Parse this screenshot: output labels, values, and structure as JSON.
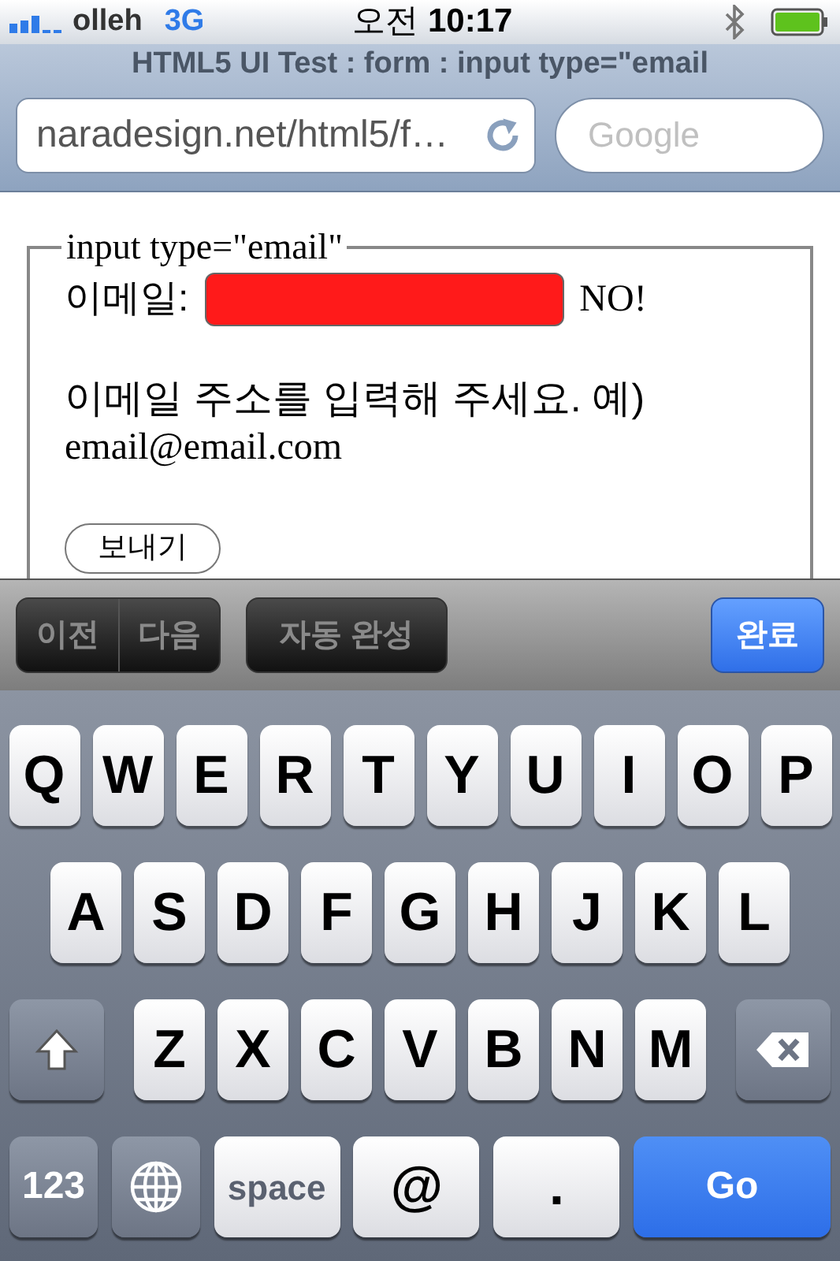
{
  "status_bar": {
    "carrier": "olleh",
    "network": "3G",
    "meridiem": "오전",
    "time": "10:17"
  },
  "browser": {
    "title": "HTML5 UI Test : form : input type=\"email",
    "address": "naradesign.net/html5/f…",
    "search_placeholder": "Google"
  },
  "form": {
    "legend": "input type=\"email\"",
    "field_label": "이메일:",
    "field_invalid": true,
    "field_message": "NO!",
    "hint": "이메일 주소를 입력해 주세요. 예)",
    "example": "email@email.com",
    "submit": "보내기"
  },
  "form_toolbar": {
    "nav": [
      {
        "label": "이전",
        "disabled": true
      },
      {
        "label": "다음",
        "disabled": true
      }
    ],
    "autofill": {
      "label": "자동 완성",
      "disabled": true
    },
    "done": "완료"
  },
  "keyboard": {
    "letter_rows": [
      [
        {
          "kind": "letter",
          "label": "Q"
        },
        {
          "kind": "letter",
          "label": "W"
        },
        {
          "kind": "letter",
          "label": "E"
        },
        {
          "kind": "letter",
          "label": "R"
        },
        {
          "kind": "letter",
          "label": "T"
        },
        {
          "kind": "letter",
          "label": "Y"
        },
        {
          "kind": "letter",
          "label": "U"
        },
        {
          "kind": "letter",
          "label": "I"
        },
        {
          "kind": "letter",
          "label": "O"
        },
        {
          "kind": "letter",
          "label": "P"
        }
      ],
      [
        {
          "kind": "letter",
          "label": "A"
        },
        {
          "kind": "letter",
          "label": "S"
        },
        {
          "kind": "letter",
          "label": "D"
        },
        {
          "kind": "letter",
          "label": "F"
        },
        {
          "kind": "letter",
          "label": "G"
        },
        {
          "kind": "letter",
          "label": "H"
        },
        {
          "kind": "letter",
          "label": "J"
        },
        {
          "kind": "letter",
          "label": "K"
        },
        {
          "kind": "letter",
          "label": "L"
        }
      ],
      [
        {
          "kind": "shift"
        },
        {
          "kind": "letter",
          "label": "Z"
        },
        {
          "kind": "letter",
          "label": "X"
        },
        {
          "kind": "letter",
          "label": "C"
        },
        {
          "kind": "letter",
          "label": "V"
        },
        {
          "kind": "letter",
          "label": "B"
        },
        {
          "kind": "letter",
          "label": "N"
        },
        {
          "kind": "letter",
          "label": "M"
        },
        {
          "kind": "backspace"
        }
      ]
    ],
    "bottom_row": [
      {
        "kind": "function",
        "label": "123"
      },
      {
        "kind": "globe"
      },
      {
        "kind": "space",
        "label": "space"
      },
      {
        "kind": "symbol",
        "label": "@"
      },
      {
        "kind": "symbol",
        "label": "."
      },
      {
        "kind": "go",
        "label": "Go"
      }
    ]
  }
}
